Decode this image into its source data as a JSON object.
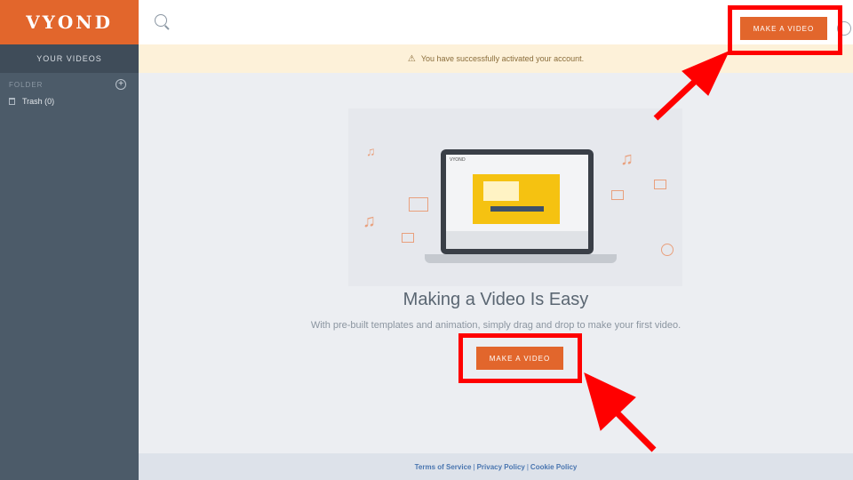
{
  "sidebar": {
    "logo": "VYOND",
    "your_videos_label": "YOUR VIDEOS",
    "folder_label": "FOLDER",
    "add_folder_glyph": "+",
    "trash_label": "Trash (0)"
  },
  "topbar": {
    "search_icon": "search-icon",
    "make_video_label": "MAKE A VIDEO",
    "help_icon": "help-icon"
  },
  "notice": {
    "icon": "⚠",
    "text": "You have successfully activated your account."
  },
  "main": {
    "headline": "Making a Video Is Easy",
    "subtext": "With pre-built templates and animation, simply drag and drop to make your first video.",
    "make_video_label": "MAKE A VIDEO",
    "laptop_logo": "VYOND"
  },
  "footer": {
    "terms": "Terms of Service",
    "privacy": "Privacy Policy",
    "cookie": "Cookie Policy",
    "separator": "|"
  },
  "colors": {
    "brand_orange": "#e2662c",
    "sidebar": "#4c5b69",
    "annotation_red": "#ff0000"
  }
}
